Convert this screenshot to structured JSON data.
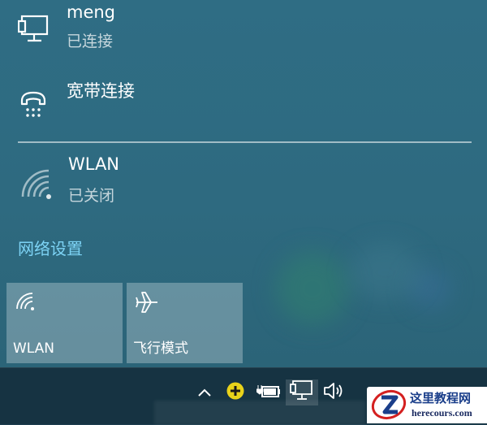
{
  "network_list": {
    "items": [
      {
        "name": "meng",
        "status": "已连接",
        "icon": "ethernet-monitor-icon"
      },
      {
        "name": "宽带连接",
        "status": "",
        "icon": "dialup-phone-icon"
      },
      {
        "name": "WLAN",
        "status": "已关闭",
        "icon": "wifi-icon"
      }
    ]
  },
  "settings_link": {
    "label": "网络设置"
  },
  "quick_actions": [
    {
      "label": "WLAN",
      "icon": "wifi-icon"
    },
    {
      "label": "飞行模式",
      "icon": "airplane-icon"
    }
  ],
  "tray": {
    "icons": [
      "chevron-up-icon",
      "plus-badge-icon",
      "power-plug-icon",
      "network-monitor-icon",
      "speaker-icon"
    ]
  },
  "watermark": {
    "title": "这里教程网",
    "url": "herecours.com"
  },
  "colors": {
    "flyout_bg": "#2e6a80",
    "link": "#7dd3f5",
    "taskbar": "#163342",
    "tray_badge": "#e8d21a"
  }
}
